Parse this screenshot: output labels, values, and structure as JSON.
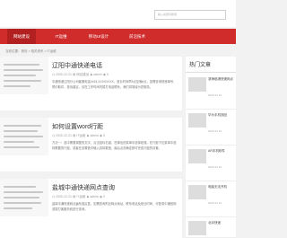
{
  "search": {
    "placeholder": "输入关键词搜索"
  },
  "nav": {
    "items": [
      "网站建设",
      "IT运维",
      "移动UI设计",
      "前沿技术"
    ]
  },
  "breadcrumb": "当前位置：首页 > 相关资讯 > IT运维",
  "articles": [
    {
      "title": "辽阳中通快递电话",
      "date": "2020-12-21",
      "category": "网站建设",
      "author": "admin",
      "views": "0",
      "excerpt": "中通快递辽阳分公司客服电话0419-XXXXXXXX，营业时间早8点至晚6点，如需查询快递单号、预约取件、投诉建议，请在工作时间内拨打电话联系，我们将竭诚为您服务。"
    },
    {
      "title": "如何设置word行距",
      "date": "2020-12-21",
      "category": "IT运维",
      "author": "admin",
      "views": "0",
      "excerpt": "方法一：选中需要调整的文字，点击鼠标右键，在弹出的菜单中选择段落，在行距下拉菜单中选择需要的行距，或者在设置值中输入具体数值，最后点击确定即可完成行距的设置。"
    },
    {
      "title": "盐城中通快递网点查询",
      "date": "2020-12-21",
      "category": "IT运维",
      "author": "admin",
      "views": "0",
      "excerpt": "盐城中通快递网点遍布各区县，如需查询附近网点地址、联系电话及营业时间，可登录中通官网或拨打客服热线进行查询。"
    }
  ],
  "sidebar": {
    "title": "热门文章",
    "items": [
      {
        "title": "滨海临港快递网点",
        "date": "2020-12-21"
      },
      {
        "title": "华为手机找回",
        "date": "2020-12-21"
      },
      {
        "title": "AR手机软件",
        "date": "2020-12-21"
      },
      {
        "title": "电脑无法开机",
        "date": "2020-12-21"
      },
      {
        "title": "北京快递",
        "date": "2020-12-21"
      }
    ]
  },
  "colors": {
    "accent": "#d12c2c",
    "active": "#b32020"
  }
}
